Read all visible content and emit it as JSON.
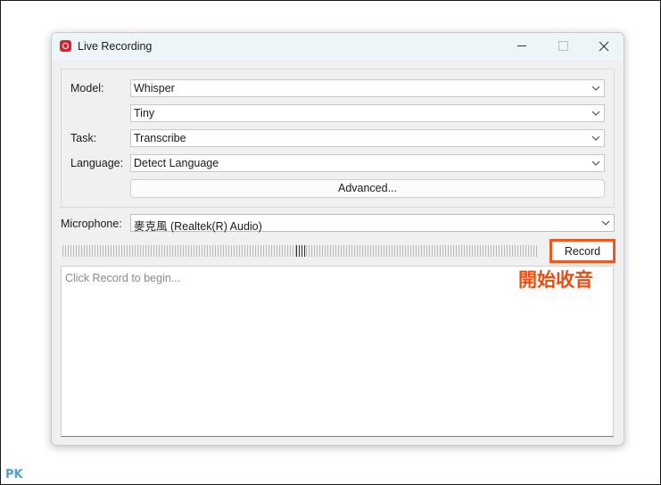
{
  "window": {
    "title": "Live Recording"
  },
  "settings": {
    "model_label": "Model:",
    "model_value": "Whisper",
    "model_size_value": "Tiny",
    "task_label": "Task:",
    "task_value": "Transcribe",
    "language_label": "Language:",
    "language_value": "Detect Language",
    "advanced_label": "Advanced..."
  },
  "microphone": {
    "label": "Microphone:",
    "value": "麥克風 (Realtek(R) Audio)"
  },
  "record": {
    "button_label": "Record",
    "annotation": "開始收音",
    "accent_color": "#ec5a1f"
  },
  "transcript": {
    "placeholder": "Click Record to begin..."
  },
  "watermark": "PK",
  "icons": {
    "app": "record-icon",
    "minimize": "minimize-icon",
    "maximize": "maximize-icon",
    "close": "close-icon",
    "dropdown": "chevron-down-icon"
  }
}
